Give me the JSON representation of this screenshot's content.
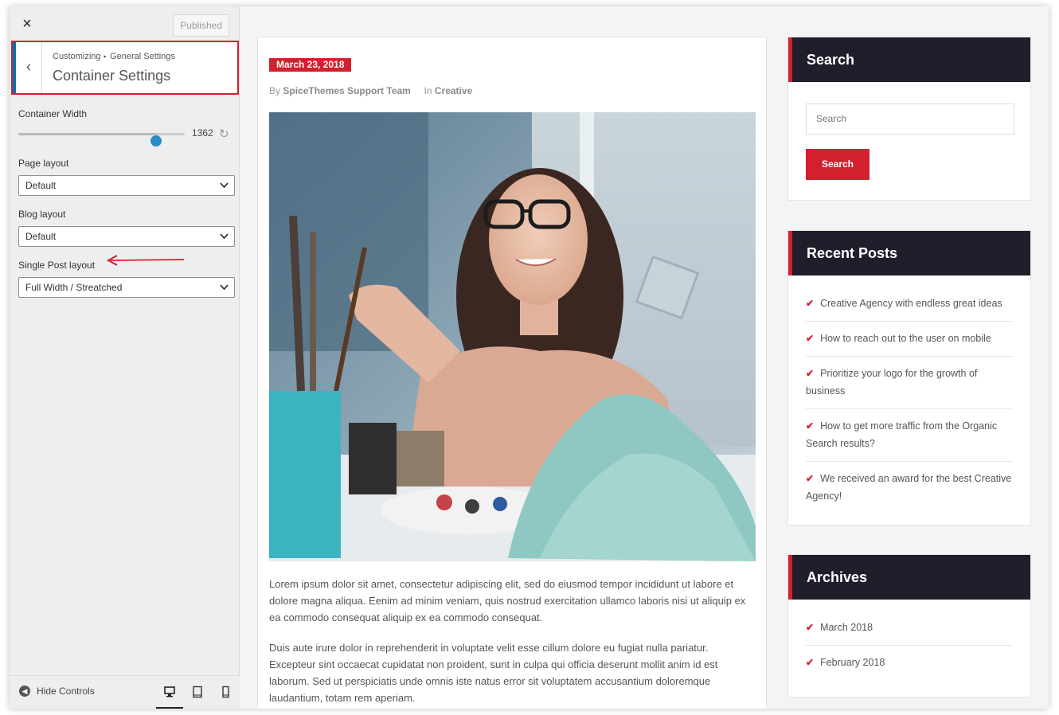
{
  "sidebar": {
    "close_icon": "×",
    "published_label": "Published",
    "back_icon": "‹",
    "breadcrumb": {
      "root": "Customizing",
      "separator": "▸",
      "parent": "General Settings"
    },
    "section_title": "Container Settings",
    "container_width": {
      "label": "Container Width",
      "value": "1362",
      "fraction": 0.83
    },
    "page_layout": {
      "label": "Page layout",
      "selected": "Default"
    },
    "blog_layout": {
      "label": "Blog layout",
      "selected": "Default"
    },
    "single_post_layout": {
      "label": "Single Post layout",
      "selected": "Full Width / Streatched"
    },
    "footer": {
      "hide_controls_label": "Hide Controls"
    },
    "devices": [
      "desktop-icon",
      "tablet-icon",
      "mobile-icon"
    ]
  },
  "post": {
    "date": "March 23, 2018",
    "by_label": "By",
    "author": "SpiceThemes Support Team",
    "in_label": "In",
    "category": "Creative",
    "paragraphs": [
      "Lorem ipsum dolor sit amet, consectetur adipiscing elit, sed do eiusmod tempor incididunt ut labore et dolore magna aliqua. Eenim ad minim veniam, quis nostrud exercitation ullamco laboris nisi ut aliquip ex ea commodo consequat aliquip ex ea commodo consequat.",
      "Duis aute irure dolor in reprehenderit in voluptate velit esse cillum dolore eu fugiat nulla pariatur. Excepteur sint occaecat cupidatat non proident, sunt in culpa qui officia deserunt mollit anim id est laborum. Sed ut perspiciatis unde omnis iste natus error sit voluptatem accusantium doloremque laudantium, totam rem aperiam."
    ]
  },
  "widgets": {
    "search": {
      "title": "Search",
      "placeholder": "Search",
      "button": "Search"
    },
    "recent_posts": {
      "title": "Recent Posts",
      "items": [
        "Creative Agency with endless great ideas",
        "How to reach out to the user on mobile",
        "Prioritize your logo for the growth of business",
        "How to get more traffic from the Organic Search results?",
        "We received an award for the best Creative Agency!"
      ]
    },
    "archives": {
      "title": "Archives",
      "items": [
        "March 2018",
        "February 2018"
      ]
    }
  },
  "colors": {
    "accent": "#d3202f",
    "widget_header": "#1f1e2b",
    "slider": "#2a8bc9"
  }
}
